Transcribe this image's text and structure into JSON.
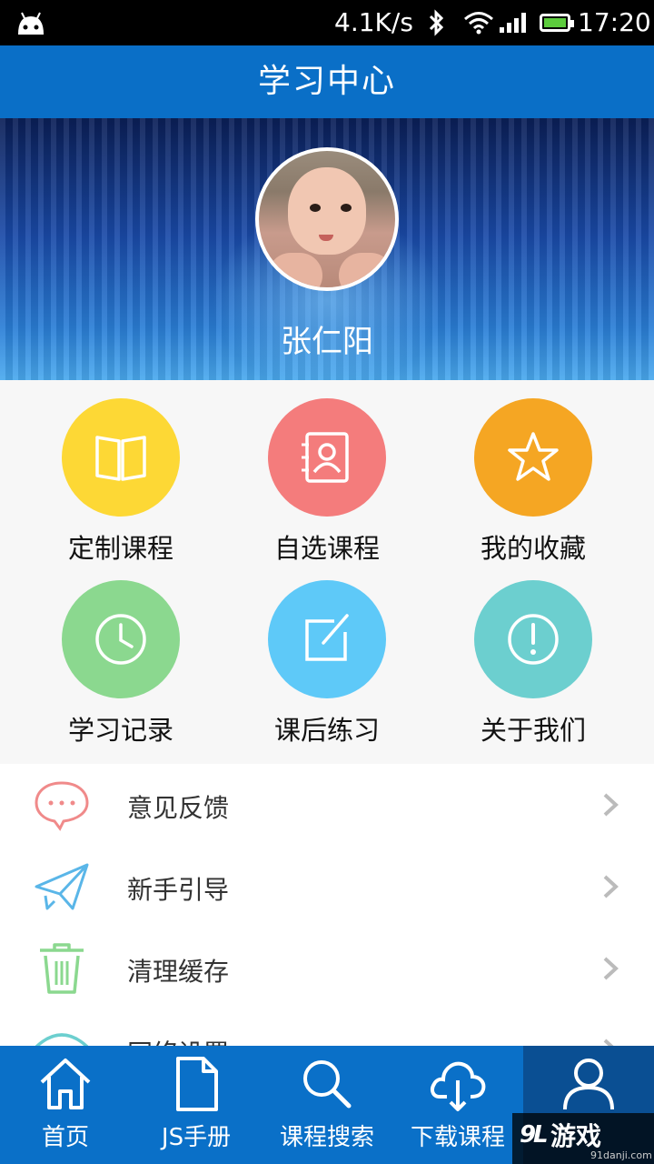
{
  "status_bar": {
    "speed": "4.1K/s",
    "time": "17:20",
    "battery_color": "#5ccc3d"
  },
  "title_bar": {
    "title": "学习中心"
  },
  "profile": {
    "name": "张仁阳"
  },
  "grid_items": [
    {
      "label": "定制课程",
      "icon": "book-icon",
      "color": "#fdd835"
    },
    {
      "label": "自选课程",
      "icon": "contact-book-icon",
      "color": "#f47c7c"
    },
    {
      "label": "我的收藏",
      "icon": "star-icon",
      "color": "#f5a623"
    },
    {
      "label": "学习记录",
      "icon": "clock-icon",
      "color": "#8bd88f"
    },
    {
      "label": "课后练习",
      "icon": "edit-icon",
      "color": "#5ec9f8"
    },
    {
      "label": "关于我们",
      "icon": "info-icon",
      "color": "#6ccfcf"
    }
  ],
  "list_items": [
    {
      "label": "意见反馈",
      "icon": "chat-bubble-icon"
    },
    {
      "label": "新手引导",
      "icon": "paper-plane-icon"
    },
    {
      "label": "清理缓存",
      "icon": "trash-icon"
    },
    {
      "label": "网络设置",
      "icon": "wifi-icon"
    }
  ],
  "tab_bar": [
    {
      "label": "首页",
      "icon": "home-icon"
    },
    {
      "label": "JS手册",
      "icon": "document-icon"
    },
    {
      "label": "课程搜索",
      "icon": "search-icon"
    },
    {
      "label": "下载课程",
      "icon": "cloud-download-icon"
    },
    {
      "label": "",
      "icon": "user-icon",
      "active": true
    }
  ],
  "watermark": {
    "main": "游戏",
    "sub": "91danji.com"
  },
  "colors": {
    "accent": "#0a6fc7",
    "tab_active": "#0a4f93"
  }
}
